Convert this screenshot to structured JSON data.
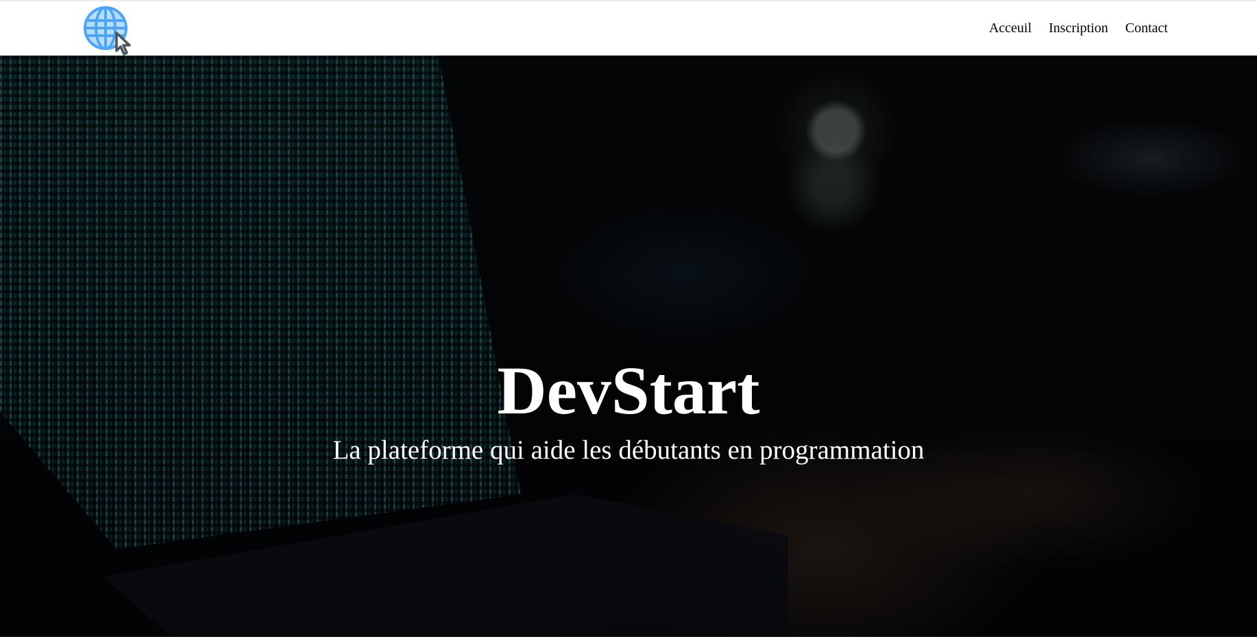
{
  "header": {
    "logo": {
      "icon": "globe-cursor-icon",
      "colors": {
        "globe": "#4da6f5",
        "fill": "#b9dcf9",
        "cursor": "#4a5358"
      }
    },
    "nav": [
      {
        "label": "Acceuil"
      },
      {
        "label": "Inscription"
      },
      {
        "label": "Contact"
      }
    ]
  },
  "hero": {
    "title": "DevStart",
    "subtitle": "La plateforme qui aide les débutants en programmation"
  }
}
